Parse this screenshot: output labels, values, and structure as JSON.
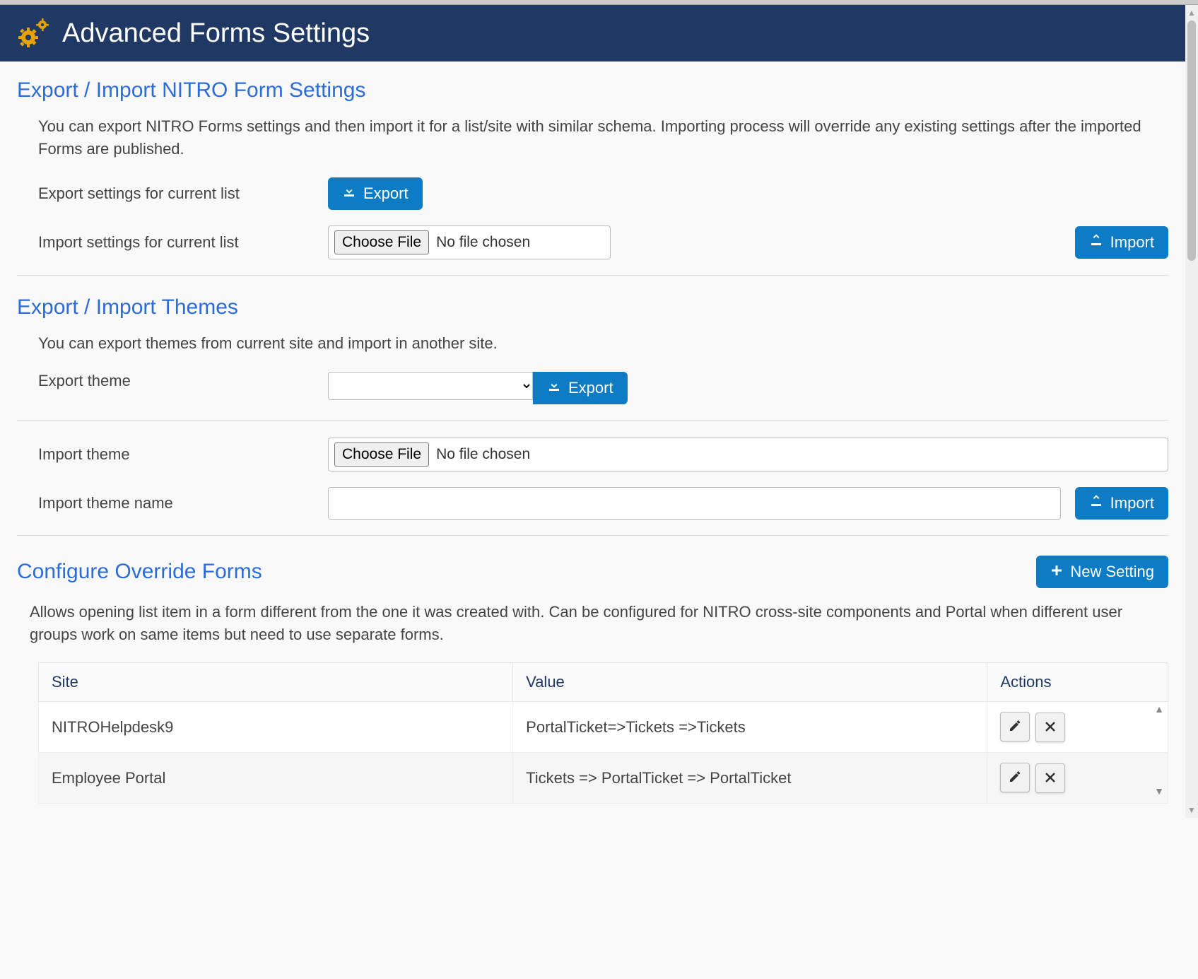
{
  "header": {
    "title": "Advanced Forms Settings"
  },
  "section1": {
    "title": "Export / Import NITRO Form Settings",
    "desc": "You can export NITRO Forms settings and then import it for a list/site with similar schema. Importing process will override any existing settings after the imported Forms are published.",
    "export_label": "Export settings for current list",
    "import_label": "Import settings for current list",
    "export_btn": "Export",
    "import_btn": "Import",
    "choose_file_btn": "Choose File",
    "file_status": "No file chosen"
  },
  "section2": {
    "title": "Export / Import Themes",
    "desc": "You can export themes from current site and import in another site.",
    "export_theme_label": "Export theme",
    "import_theme_label": "Import theme",
    "import_theme_name_label": "Import theme name",
    "export_btn": "Export",
    "import_btn": "Import",
    "choose_file_btn": "Choose File",
    "file_status": "No file chosen",
    "theme_select_value": "",
    "import_theme_name_value": ""
  },
  "section3": {
    "title": "Configure Override Forms",
    "new_setting_btn": "New Setting",
    "desc": "Allows opening list item in a form different from the one it was created with. Can be configured for NITRO cross-site components and Portal when different user groups work on same items but need to use separate forms.",
    "columns": {
      "site": "Site",
      "value": "Value",
      "actions": "Actions"
    },
    "rows": [
      {
        "site": "NITROHelpdesk9",
        "value": "PortalTicket=>Tickets =>Tickets"
      },
      {
        "site": "Employee Portal",
        "value": "Tickets => PortalTicket => PortalTicket"
      }
    ]
  }
}
